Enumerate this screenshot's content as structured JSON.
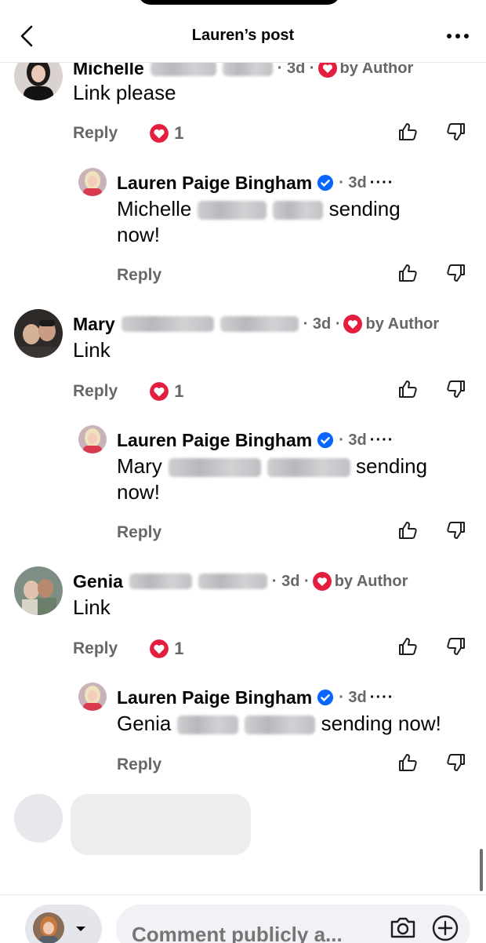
{
  "header": {
    "title": "Lauren’s post",
    "back_icon": "chevron-left-icon",
    "more_icon": "more-horizontal-icon"
  },
  "colors": {
    "heart": "#e41e3f",
    "verified": "#0866ff",
    "secondary_text": "#65676b"
  },
  "comments": [
    {
      "author": "Michelle",
      "time": "· 3d ·",
      "author_tag": "by Author",
      "text": "Link please",
      "reply_label": "Reply",
      "reaction_count": "1",
      "reply": {
        "author": "Lauren Paige Bingham",
        "time": "· 3d",
        "more": "····",
        "text_start": "Michelle",
        "text_end": "sending",
        "text_line2": "now!",
        "reply_label": "Reply"
      }
    },
    {
      "author": "Mary",
      "time": "· 3d ·",
      "author_tag": "by Author",
      "text": "Link",
      "reply_label": "Reply",
      "reaction_count": "1",
      "reply": {
        "author": "Lauren Paige Bingham",
        "time": "· 3d",
        "more": "····",
        "text_start": "Mary",
        "text_end": "sending",
        "text_line2": "now!",
        "reply_label": "Reply"
      }
    },
    {
      "author": "Genia",
      "time": "· 3d ·",
      "author_tag": "by Author",
      "text": "Link",
      "reply_label": "Reply",
      "reaction_count": "1",
      "reply": {
        "author": "Lauren Paige Bingham",
        "time": "· 3d",
        "more": "····",
        "text_start": "Genia",
        "text_end": "sending now!",
        "text_line2": "",
        "reply_label": "Reply"
      }
    }
  ],
  "composer": {
    "placeholder": "Comment publicly a...",
    "camera_icon": "camera-icon",
    "add_icon": "plus-circle-icon"
  }
}
